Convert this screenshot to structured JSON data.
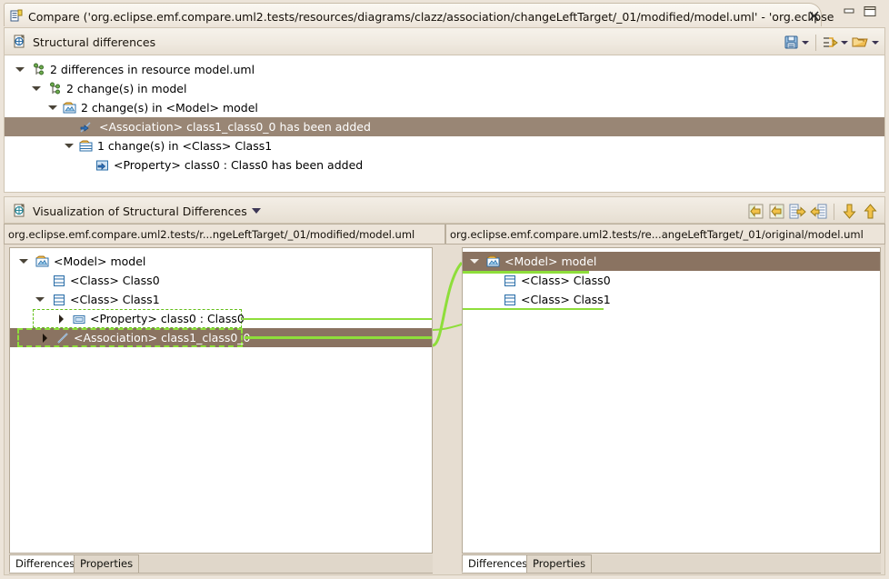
{
  "window": {
    "tab_title": "Compare ('org.eclipse.emf.compare.uml2.tests/resources/diagrams/clazz/association/changeLeftTarget/_01/modified/model.uml' - 'org.eclipse",
    "tab_icon": "compare-editor-icon",
    "close_icon": "close-icon",
    "minimize_icon": "minimize-icon",
    "maximize_icon": "maximize-icon"
  },
  "structural": {
    "title": "Structural differences",
    "header_icon": "structural-differences-icon",
    "toolbar": [
      {
        "name": "save-icon",
        "label": "save"
      },
      {
        "name": "group-by-icon",
        "label": "grouping"
      },
      {
        "name": "filter-folder-icon",
        "label": "filters"
      }
    ],
    "tree": [
      {
        "label": "2 differences in resource model.uml",
        "icon": "diff-resource-icon",
        "indent": 0,
        "twisty": "down",
        "selected": false
      },
      {
        "label": "2 change(s) in model",
        "icon": "diff-resource-icon",
        "indent": 1,
        "twisty": "down",
        "selected": false
      },
      {
        "label": "2 change(s) in <Model> model",
        "icon": "model-icon",
        "indent": 2,
        "twisty": "down",
        "selected": false
      },
      {
        "label": "<Association> class1_class0_0 has been added",
        "icon": "association-added-icon",
        "indent": 3,
        "twisty": "none",
        "selected": true
      },
      {
        "label": "1 change(s) in <Class> Class1",
        "icon": "class-change-icon",
        "indent": 3,
        "twisty": "down",
        "selected": false
      },
      {
        "label": "<Property> class0 : Class0 has been added",
        "icon": "property-added-icon",
        "indent": 4,
        "twisty": "none",
        "selected": false
      }
    ]
  },
  "visualization": {
    "title": "Visualization of Structural Differences",
    "header_icon": "visualization-icon",
    "menu_icon": "chevron-down-icon",
    "toolbar": [
      {
        "name": "copy-right-to-left-icon",
        "label": "Copy current change right to left"
      },
      {
        "name": "copy-left-to-right-icon",
        "label": "Copy current change left to right"
      },
      {
        "name": "copy-all-right-to-left-icon",
        "label": "Copy all right to left"
      },
      {
        "name": "copy-all-left-to-right-icon",
        "label": "Copy all left to right"
      },
      {
        "name": "next-difference-icon",
        "label": "Next difference"
      },
      {
        "name": "previous-difference-icon",
        "label": "Previous difference"
      }
    ],
    "left_path": "org.eclipse.emf.compare.uml2.tests/r...ngeLeftTarget/_01/modified/model.uml",
    "right_path": "org.eclipse.emf.compare.uml2.tests/re...angeLeftTarget/_01/original/model.uml",
    "left_tree": [
      {
        "label": "<Model> model",
        "icon": "model-icon",
        "indent": 0,
        "twisty": "down",
        "state": "normal"
      },
      {
        "label": "<Class> Class0",
        "icon": "class-icon",
        "indent": 2,
        "twisty": "none",
        "state": "normal"
      },
      {
        "label": "<Class> Class1",
        "icon": "class-icon",
        "indent": 1,
        "twisty": "down",
        "state": "normal"
      },
      {
        "label": "<Property> class0 : Class0",
        "icon": "property-icon",
        "indent": 3,
        "twisty": "right",
        "state": "added"
      },
      {
        "label": "<Association> class1_class0_0",
        "icon": "association-icon",
        "indent": 2,
        "twisty": "right",
        "state": "selected-added"
      }
    ],
    "right_tree": [
      {
        "label": "<Model> model",
        "icon": "model-icon",
        "indent": 0,
        "twisty": "down",
        "state": "selected"
      },
      {
        "label": "<Class> Class0",
        "icon": "class-icon",
        "indent": 2,
        "twisty": "none",
        "state": "normal"
      },
      {
        "label": "<Class> Class1",
        "icon": "class-icon",
        "indent": 2,
        "twisty": "none",
        "state": "normal"
      }
    ],
    "left_tabs": [
      {
        "label": "Differences",
        "active": true
      },
      {
        "label": "Properties",
        "active": false
      }
    ],
    "right_tabs": [
      {
        "label": "Differences",
        "active": true
      },
      {
        "label": "Properties",
        "active": false
      }
    ]
  },
  "colors": {
    "selection": "#998675",
    "change_green": "#8ede3a",
    "dash_green": "#63c018",
    "chrome": "#ece4d9",
    "pane_bg": "#ffffff"
  }
}
